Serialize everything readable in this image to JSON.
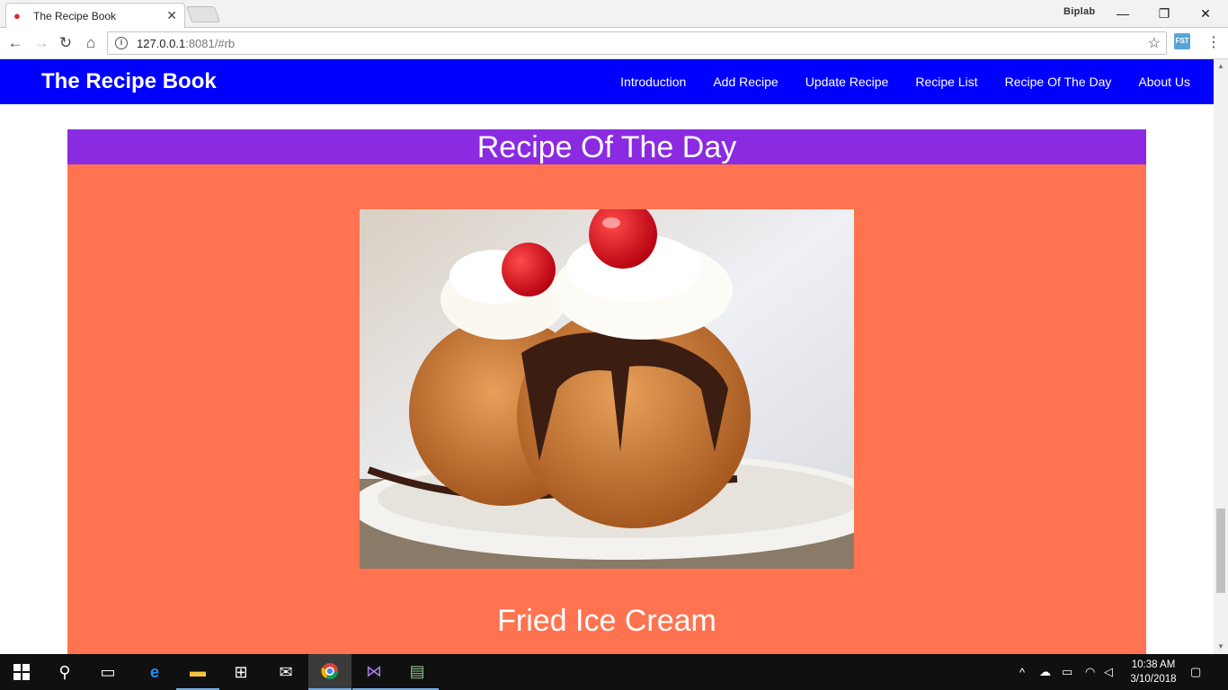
{
  "browser": {
    "tab_title": "The Recipe Book",
    "url_host": "127.0.0.1",
    "url_rest": ":8081/#rb",
    "profile_name": "Biplab",
    "ext_label": "FST"
  },
  "site": {
    "brand": "The Recipe Book",
    "nav": [
      {
        "label": "Introduction"
      },
      {
        "label": "Add Recipe"
      },
      {
        "label": "Update Recipe"
      },
      {
        "label": "Recipe List"
      },
      {
        "label": "Recipe Of The Day"
      },
      {
        "label": "About Us"
      }
    ],
    "colors": {
      "navbar": "#0000ff",
      "section_header": "#8a2be2",
      "card": "#ff7350"
    }
  },
  "section": {
    "title": "Recipe Of The Day",
    "recipe_name": "Fried Ice Cream"
  },
  "taskbar": {
    "time": "10:38 AM",
    "date": "3/10/2018"
  }
}
